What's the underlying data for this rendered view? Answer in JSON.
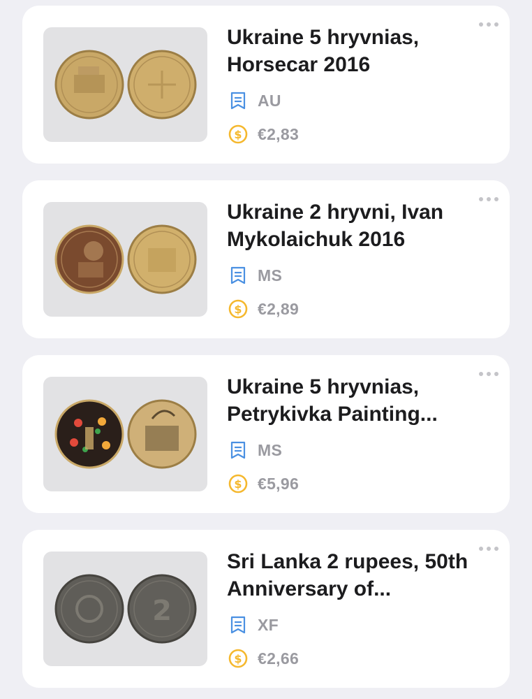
{
  "items": [
    {
      "title": "Ukraine 5 hryvnias, Horsecar 2016",
      "grade": "AU",
      "price": "€2,83"
    },
    {
      "title": "Ukraine 2 hryvni, Ivan Mykolaichuk 2016",
      "grade": "MS",
      "price": "€2,89"
    },
    {
      "title": "Ukraine 5 hryvnias, Petrykivka Painting...",
      "grade": "MS",
      "price": "€5,96"
    },
    {
      "title": "Sri Lanka 2 rupees, 50th Anniversary of...",
      "grade": "XF",
      "price": "€2,66"
    }
  ],
  "icons": {
    "grade": "grade-icon",
    "price": "coin-dollar-icon",
    "more": "more-options-icon"
  },
  "colors": {
    "background": "#efeff4",
    "card": "#ffffff",
    "grade_icon": "#4a90e2",
    "price_icon": "#f5b82e",
    "meta_text": "#9a9aa0"
  }
}
